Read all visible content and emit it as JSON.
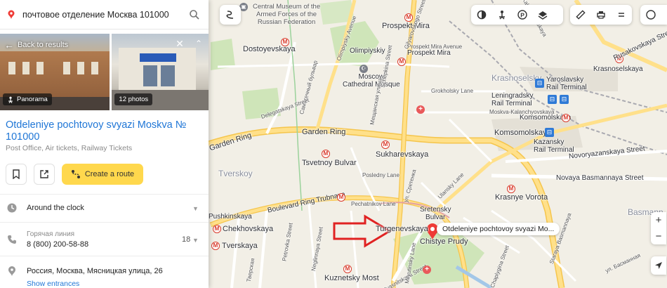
{
  "search": {
    "query": "почтовое отделение Москва 101000"
  },
  "photos": {
    "back_label": "Back to results",
    "panorama_label": "Panorama",
    "photos_count_label": "12 photos"
  },
  "place": {
    "title": "Otdeleniye pochtovoy svyazi Moskva № 101000",
    "category": "Post Office, Air tickets, Railway Tickets",
    "route_label": "Create a route",
    "hours": "Around the clock",
    "hotline_label": "Горячая линия",
    "hotline_number": "8 (800) 200-58-88",
    "hotline_count": "18",
    "address": "Россия, Москва, Мясницкая улица, 26",
    "entrances_label": "Show entrances"
  },
  "map": {
    "pin_label": "Otdeleniye pochtovoy svyazi Mo...",
    "labels": {
      "museum": "Central Museum of the\nArmed Forces of the\nRussian Federation",
      "prospekt_mira_top": "Prospekt Mira",
      "prospekt_mira_2": "Prospekt Mira",
      "olimpiyskiy": "Olimpiyskiy",
      "mosque": "Moscow\nCathedral Mosque",
      "dostoyevskaya": "Dostoyevskaya",
      "krasnoselsky": "Krasnoselsky",
      "krasnoselskaya": "Krasnoselskaya",
      "yaroslavsky": "Yaroslavsky\nRail Terminal",
      "leningradsky": "Leningradsky\nRail Terminal",
      "komsomolskaya": "Komsomolskaya",
      "komsomolskaya2": "Komsomolskaya",
      "kazansky": "Kazansky\nRail Terminal",
      "garden_ring_left": "Garden Ring",
      "garden_ring": "Garden Ring",
      "sukharevskaya": "Sukharevskaya",
      "tsvetnoy": "Tsvetnoy Bulvar",
      "tverskoy": "Tverskoy",
      "trubnaya": "Boulevard Ring Trubnaya",
      "sretensky": "Sretensky\nBulvar",
      "turgenevskaya": "Turgenevskaya",
      "chistye": "Chistye Prudy",
      "krasnye_vorota": "Krasnye Vorota",
      "chekhovskaya": "Chekhovskaya",
      "pushkinskaya": "Pushkinskaya",
      "tverskaya": "Tverskaya",
      "kuznetsky": "Kuznetsky Most",
      "basmanny": "Basmann",
      "novaya_basmannaya": "Novaya Basmannaya Street",
      "novoryazanskaya": "Novoryazanskaya Street",
      "rusakovskaya": "Rusakovskaya Street",
      "moskva_kalanchevskaya": "Moskva-Kalanchyovskaya",
      "gokholsky": "Grokholsky Lane",
      "prospekt_mira_ave": "Prospekt Mira Avenue",
      "olimpiysky_ave": "Olimpiysky Avenue",
      "samotechny": "Самотечный бульвар",
      "delegatskaya": "Delegatskaya Street",
      "gilyarovskogo": "Gilyarovskogo Street",
      "meshchanskaya": "Мещанская улица",
      "scheplina": "Schepkina Street",
      "sretenka": "ул. Сретенка",
      "posledny": "Posledny Lane",
      "pechatnikov": "Pechatnikov Lane",
      "ulansky": "Ulansky Lane",
      "chaplygina": "Chaplygina Street",
      "petrovka": "Petrovka Street",
      "tverskaya_st": "Тверская",
      "myasnitskaya": "Myasnitskaya Street",
      "milyutinsky": "Milyutinsky Lane",
      "lubyanka": "Lubyanka",
      "basmannaya_st": "ул. Басманная",
      "aleksandra": "Staraya Basmannaya",
      "kalanchyovskaya": "Kalanchyovskaya",
      "neglinnaya": "Neglinnaya Street"
    }
  }
}
